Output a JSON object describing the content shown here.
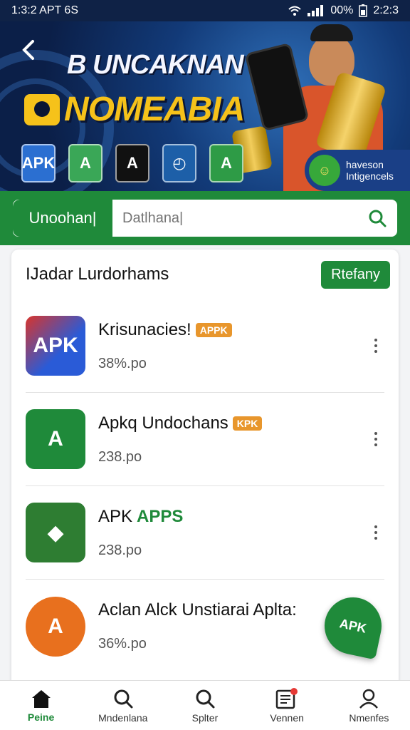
{
  "status_bar": {
    "time": "1:3:2 APT 6S",
    "battery": "00%",
    "clock": "2:2:3"
  },
  "hero": {
    "title_line1": "B UNCAKNAN",
    "title_line2": "NOMEABIA",
    "app_tiles": [
      {
        "label": "APK",
        "color": "#2b6fd1"
      },
      {
        "label": "A",
        "color": "#3aa757"
      },
      {
        "label": "A",
        "color": "#111111"
      },
      {
        "label": "◴",
        "color": "#1d5fa8"
      },
      {
        "label": "A",
        "color": "#2e9b46"
      }
    ],
    "badge_line1": "haveson",
    "badge_line2": "Intigencels"
  },
  "search": {
    "label": "Unoohan|",
    "placeholder": "Datlhana|"
  },
  "card": {
    "title": "IJadar Lurdorhams",
    "action_label": "Rtefany",
    "items": [
      {
        "name": "Krisunacies!",
        "name_green": "",
        "badge": "APPK",
        "size": "38%.po",
        "icon_text": "APK",
        "icon_color": "#2a5bd7",
        "icon": "apk-icon"
      },
      {
        "name": "Apkq Undochans",
        "name_green": "",
        "badge": "KPK",
        "size": "238.po",
        "icon_text": "A",
        "icon_color": "#1f8a3a",
        "icon": "apk-a-icon"
      },
      {
        "name": "APK ",
        "name_green": "APPS",
        "badge": "",
        "size": "238.po",
        "icon_text": "◆",
        "icon_color": "#2e7d32",
        "icon": "android-icon"
      },
      {
        "name": "Aclan Alck Unstiarai Aplta:",
        "name_green": "",
        "badge": "",
        "size": "36%.po",
        "icon_text": "A",
        "icon_color": "#e8701e",
        "icon": "apk-orange-icon"
      }
    ]
  },
  "fab": {
    "label": "APK"
  },
  "bottom_nav": [
    {
      "label": "Peine",
      "icon": "home-icon"
    },
    {
      "label": "Mndenlana",
      "icon": "search-icon"
    },
    {
      "label": "Splter",
      "icon": "search-icon"
    },
    {
      "label": "Vennen",
      "icon": "news-icon"
    },
    {
      "label": "Nmenfes",
      "icon": "profile-icon"
    }
  ],
  "colors": {
    "primary": "#1f8a3a",
    "accent": "#e8962c",
    "hero_bg": "#123a78"
  }
}
